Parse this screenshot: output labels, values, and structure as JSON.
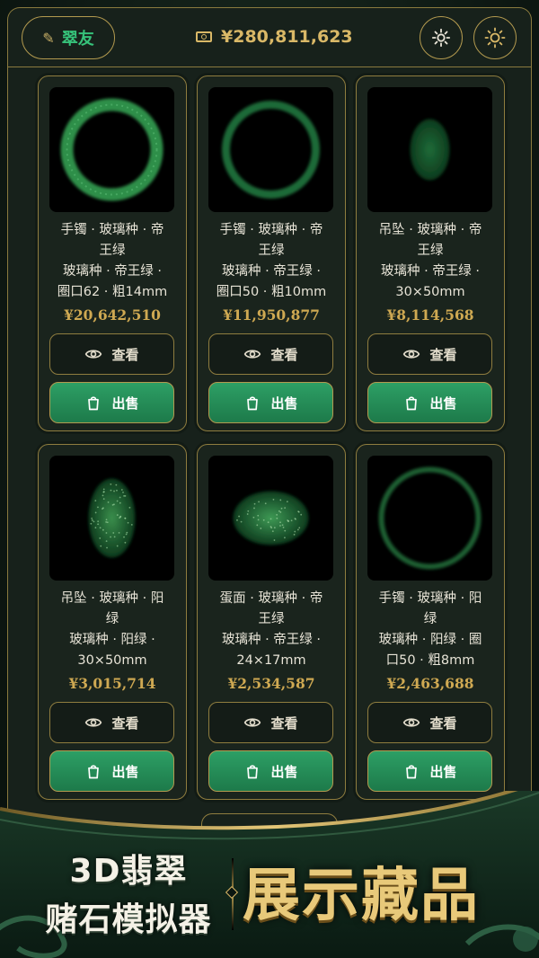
{
  "header": {
    "username": "翠友",
    "balance": "¥280,811,623",
    "icons": {
      "user": "pencil-icon",
      "balance": "cash-icon",
      "settings": "gear-icon",
      "theme": "sun-icon"
    }
  },
  "items": [
    {
      "title_line1": "手镯 · 玻璃种 · 帝",
      "title_line2": "王绿",
      "detail_line1": "玻璃种 · 帝王绿 ·",
      "detail_line2": "圈口62 · 粗14mm",
      "price": "¥20,642,510",
      "shape": "bangle",
      "color": "#2d8f4a"
    },
    {
      "title_line1": "手镯 · 玻璃种 · 帝",
      "title_line2": "王绿",
      "detail_line1": "玻璃种 · 帝王绿 ·",
      "detail_line2": "圈口50 · 粗10mm",
      "price": "¥11,950,877",
      "shape": "bangle-thin",
      "color": "#1f6b39"
    },
    {
      "title_line1": "吊坠 · 玻璃种 · 帝",
      "title_line2": "王绿",
      "detail_line1": "玻璃种 · 帝王绿 ·",
      "detail_line2": "30×50mm",
      "price": "¥8,114,568",
      "shape": "pendant",
      "color": "#1e6b38"
    },
    {
      "title_line1": "吊坠 · 玻璃种 · 阳",
      "title_line2": "绿",
      "detail_line1": "玻璃种 · 阳绿 ·",
      "detail_line2": "30×50mm",
      "price": "¥3,015,714",
      "shape": "pendant-speckle",
      "color": "#3a8f4c"
    },
    {
      "title_line1": "蛋面 · 玻璃种 · 帝",
      "title_line2": "王绿",
      "detail_line1": "玻璃种 · 帝王绿 ·",
      "detail_line2": "24×17mm",
      "price": "¥2,534,587",
      "shape": "cabochon",
      "color": "#3e9a55"
    },
    {
      "title_line1": "手镯 · 玻璃种 · 阳",
      "title_line2": "绿",
      "detail_line1": "玻璃种 · 阳绿 · 圈",
      "detail_line2": "口50 · 粗8mm",
      "price": "¥2,463,688",
      "shape": "bangle-thin2",
      "color": "#1d5e31"
    }
  ],
  "buttons": {
    "view": "查看",
    "sell": "出售"
  },
  "banner": {
    "line1": "3D翡翠",
    "line2": "赌石模拟器",
    "slogan": "展示藏品"
  },
  "colors": {
    "accent_gold": "#d9b867",
    "jade_green": "#2d9f65",
    "background": "#17211b"
  }
}
